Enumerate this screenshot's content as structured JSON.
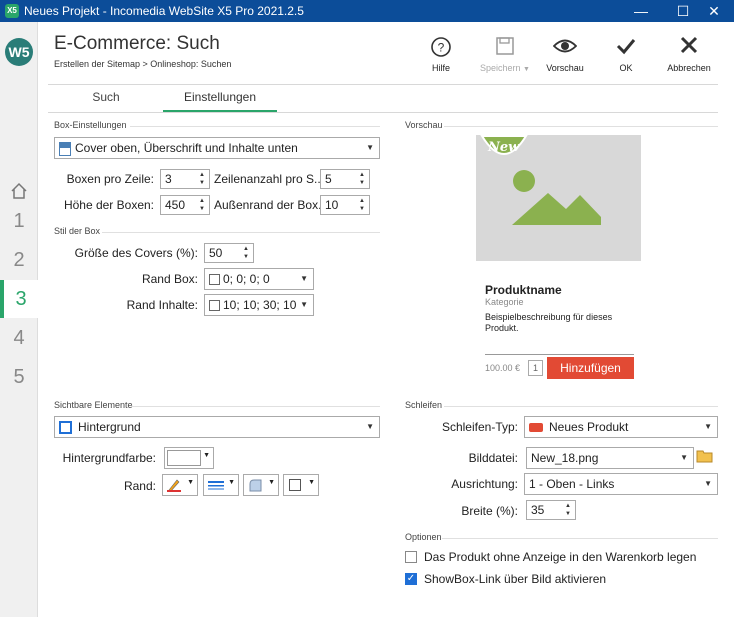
{
  "window": {
    "title": "Neues Projekt - Incomedia WebSite X5 Pro 2021.2.5",
    "app_icon": "X5",
    "minimize": "—",
    "maximize": "☐",
    "close": "✕"
  },
  "sidebar": {
    "logo": "W5",
    "home_icon": "home-icon",
    "steps": [
      "1",
      "2",
      "3",
      "4",
      "5"
    ],
    "active_step": "3"
  },
  "header": {
    "title": "E-Commerce: Such",
    "breadcrumb": "Erstellen der Sitemap > Onlineshop: Suchen",
    "toolbar": {
      "help": "Hilfe",
      "save": "Speichern",
      "preview": "Vorschau",
      "ok": "OK",
      "cancel": "Abbrechen"
    }
  },
  "tabs": [
    "Such",
    "Einstellungen"
  ],
  "box_settings": {
    "section": "Box-Einstellungen",
    "layout_select": "Cover oben, Überschrift und Inhalte unten",
    "boxes_per_row_label": "Boxen pro Zeile:",
    "boxes_per_row": "3",
    "rows_per_page_label": "Zeilenanzahl pro S...",
    "rows_per_page": "5",
    "box_height_label": "Höhe der Boxen:",
    "box_height": "450",
    "box_margin_label": "Außenrand der Box...",
    "box_margin": "10"
  },
  "box_style": {
    "section": "Stil der Box",
    "cover_size_label": "Größe des Covers (%):",
    "cover_size": "50",
    "box_border_label": "Rand Box:",
    "box_border": "0; 0; 0; 0",
    "content_border_label": "Rand Inhalte:",
    "content_border": "10; 10; 30; 10"
  },
  "visible_elements": {
    "section": "Sichtbare Elemente",
    "element_select": "Hintergrund",
    "bg_color_label": "Hintergrundfarbe:",
    "border_label": "Rand:"
  },
  "preview": {
    "section": "Vorschau",
    "badge": "New",
    "product_name": "Produktname",
    "category": "Kategorie",
    "description": "Beispielbeschreibung für dieses Produkt.",
    "price": "100.00 €",
    "quantity": "1",
    "add_button": "Hinzufügen"
  },
  "ribbon": {
    "section": "Schleifen",
    "type_label": "Schleifen-Typ:",
    "type_value": "Neues Produkt",
    "file_label": "Bilddatei:",
    "file_value": "New_18.png",
    "align_label": "Ausrichtung:",
    "align_value": "1 - Oben - Links",
    "width_label": "Breite (%):",
    "width_value": "35"
  },
  "options": {
    "section": "Optionen",
    "add_to_cart_label": "Das Produkt ohne Anzeige in den Warenkorb legen",
    "add_to_cart_checked": false,
    "showbox_label": "ShowBox-Link über Bild aktivieren",
    "showbox_checked": true
  }
}
